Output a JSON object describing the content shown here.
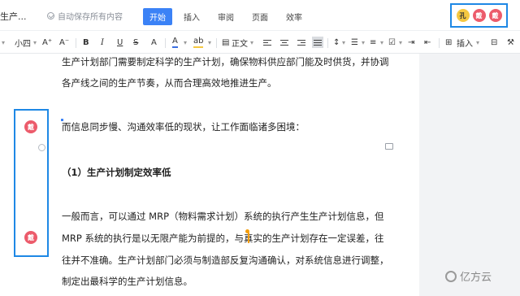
{
  "header": {
    "doc_title": "生产...",
    "save_status": "自动保存所有内容",
    "menu": [
      "开始",
      "插入",
      "审阅",
      "页面",
      "效率"
    ],
    "active_menu": "开始",
    "collaborators": [
      {
        "initial": "孔",
        "color": "#f5c842"
      },
      {
        "initial": "戴",
        "color": "#ec5b6b"
      },
      {
        "initial": "戴",
        "color": "#ec5b6b"
      }
    ]
  },
  "toolbar": {
    "font_size": "小四",
    "grow_font": "A⁺",
    "shrink_font": "A⁻",
    "bold": "B",
    "italic": "I",
    "underline": "U",
    "strike": "S",
    "clear_format": "A",
    "font_color": "A",
    "highlight": "ab",
    "paragraph_style": "正文",
    "insert": "插入"
  },
  "document": {
    "paragraphs": [
      "生产计划部门需要制定科学的生产计划，确保物料供应部门能及时供货，并协调",
      "各产线之间的生产节奏，从而合理高效地推进生产。",
      "而信息同步慢、沟通效率低的现状，让工作面临诸多困境：",
      "（1）生产计划制定效率低",
      "一般而言，可以通过 MRP（物料需求计划）系统的执行产生生产计划信息，但",
      "MRP 系统的执行是以无限产能为前提的，与真实的生产计划存在一定误差，往",
      "往并不准确。生产计划部门必须与制造部反复沟通确认，对系统信息进行调整，",
      "制定出最科学的生产计划信息。"
    ]
  },
  "side_avatars": [
    {
      "initial": "戴",
      "color": "#ec5b6b"
    },
    {
      "initial": "戴",
      "color": "#ec5b6b"
    }
  ],
  "watermark": "亿方云"
}
